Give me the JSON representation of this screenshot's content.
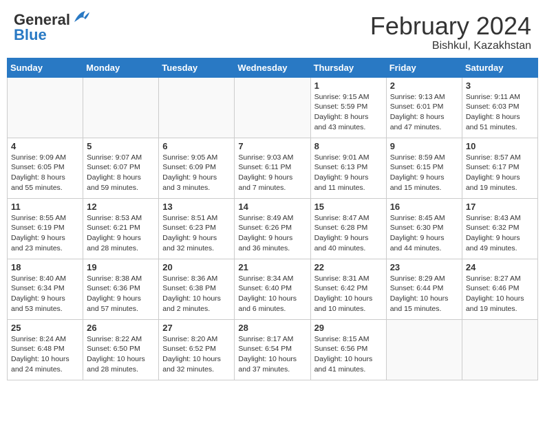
{
  "header": {
    "logo_general": "General",
    "logo_blue": "Blue",
    "title": "February 2024",
    "subtitle": "Bishkul, Kazakhstan"
  },
  "calendar": {
    "days_of_week": [
      "Sunday",
      "Monday",
      "Tuesday",
      "Wednesday",
      "Thursday",
      "Friday",
      "Saturday"
    ],
    "weeks": [
      [
        {
          "day": "",
          "info": ""
        },
        {
          "day": "",
          "info": ""
        },
        {
          "day": "",
          "info": ""
        },
        {
          "day": "",
          "info": ""
        },
        {
          "day": "1",
          "info": "Sunrise: 9:15 AM\nSunset: 5:59 PM\nDaylight: 8 hours\nand 43 minutes."
        },
        {
          "day": "2",
          "info": "Sunrise: 9:13 AM\nSunset: 6:01 PM\nDaylight: 8 hours\nand 47 minutes."
        },
        {
          "day": "3",
          "info": "Sunrise: 9:11 AM\nSunset: 6:03 PM\nDaylight: 8 hours\nand 51 minutes."
        }
      ],
      [
        {
          "day": "4",
          "info": "Sunrise: 9:09 AM\nSunset: 6:05 PM\nDaylight: 8 hours\nand 55 minutes."
        },
        {
          "day": "5",
          "info": "Sunrise: 9:07 AM\nSunset: 6:07 PM\nDaylight: 8 hours\nand 59 minutes."
        },
        {
          "day": "6",
          "info": "Sunrise: 9:05 AM\nSunset: 6:09 PM\nDaylight: 9 hours\nand 3 minutes."
        },
        {
          "day": "7",
          "info": "Sunrise: 9:03 AM\nSunset: 6:11 PM\nDaylight: 9 hours\nand 7 minutes."
        },
        {
          "day": "8",
          "info": "Sunrise: 9:01 AM\nSunset: 6:13 PM\nDaylight: 9 hours\nand 11 minutes."
        },
        {
          "day": "9",
          "info": "Sunrise: 8:59 AM\nSunset: 6:15 PM\nDaylight: 9 hours\nand 15 minutes."
        },
        {
          "day": "10",
          "info": "Sunrise: 8:57 AM\nSunset: 6:17 PM\nDaylight: 9 hours\nand 19 minutes."
        }
      ],
      [
        {
          "day": "11",
          "info": "Sunrise: 8:55 AM\nSunset: 6:19 PM\nDaylight: 9 hours\nand 23 minutes."
        },
        {
          "day": "12",
          "info": "Sunrise: 8:53 AM\nSunset: 6:21 PM\nDaylight: 9 hours\nand 28 minutes."
        },
        {
          "day": "13",
          "info": "Sunrise: 8:51 AM\nSunset: 6:23 PM\nDaylight: 9 hours\nand 32 minutes."
        },
        {
          "day": "14",
          "info": "Sunrise: 8:49 AM\nSunset: 6:26 PM\nDaylight: 9 hours\nand 36 minutes."
        },
        {
          "day": "15",
          "info": "Sunrise: 8:47 AM\nSunset: 6:28 PM\nDaylight: 9 hours\nand 40 minutes."
        },
        {
          "day": "16",
          "info": "Sunrise: 8:45 AM\nSunset: 6:30 PM\nDaylight: 9 hours\nand 44 minutes."
        },
        {
          "day": "17",
          "info": "Sunrise: 8:43 AM\nSunset: 6:32 PM\nDaylight: 9 hours\nand 49 minutes."
        }
      ],
      [
        {
          "day": "18",
          "info": "Sunrise: 8:40 AM\nSunset: 6:34 PM\nDaylight: 9 hours\nand 53 minutes."
        },
        {
          "day": "19",
          "info": "Sunrise: 8:38 AM\nSunset: 6:36 PM\nDaylight: 9 hours\nand 57 minutes."
        },
        {
          "day": "20",
          "info": "Sunrise: 8:36 AM\nSunset: 6:38 PM\nDaylight: 10 hours\nand 2 minutes."
        },
        {
          "day": "21",
          "info": "Sunrise: 8:34 AM\nSunset: 6:40 PM\nDaylight: 10 hours\nand 6 minutes."
        },
        {
          "day": "22",
          "info": "Sunrise: 8:31 AM\nSunset: 6:42 PM\nDaylight: 10 hours\nand 10 minutes."
        },
        {
          "day": "23",
          "info": "Sunrise: 8:29 AM\nSunset: 6:44 PM\nDaylight: 10 hours\nand 15 minutes."
        },
        {
          "day": "24",
          "info": "Sunrise: 8:27 AM\nSunset: 6:46 PM\nDaylight: 10 hours\nand 19 minutes."
        }
      ],
      [
        {
          "day": "25",
          "info": "Sunrise: 8:24 AM\nSunset: 6:48 PM\nDaylight: 10 hours\nand 24 minutes."
        },
        {
          "day": "26",
          "info": "Sunrise: 8:22 AM\nSunset: 6:50 PM\nDaylight: 10 hours\nand 28 minutes."
        },
        {
          "day": "27",
          "info": "Sunrise: 8:20 AM\nSunset: 6:52 PM\nDaylight: 10 hours\nand 32 minutes."
        },
        {
          "day": "28",
          "info": "Sunrise: 8:17 AM\nSunset: 6:54 PM\nDaylight: 10 hours\nand 37 minutes."
        },
        {
          "day": "29",
          "info": "Sunrise: 8:15 AM\nSunset: 6:56 PM\nDaylight: 10 hours\nand 41 minutes."
        },
        {
          "day": "",
          "info": ""
        },
        {
          "day": "",
          "info": ""
        }
      ]
    ]
  }
}
